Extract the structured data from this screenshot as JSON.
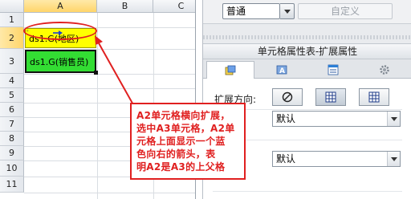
{
  "sheet": {
    "columns": [
      "A",
      "B",
      "C"
    ],
    "rows": [
      "1",
      "2",
      "3",
      "4",
      "5",
      "6",
      "7",
      "8",
      "9",
      "10",
      "11"
    ],
    "cells": {
      "a2": "ds1.G(地区)",
      "a3": "ds1.G(销售员)"
    },
    "selection_fill": "#ffff00",
    "green_fill": "#33dd33"
  },
  "panel": {
    "format_combo": "普通",
    "custom_button": "自定义",
    "title": "单元格属性表-扩展属性",
    "tab_icons": [
      "cell-format-icon",
      "text-style-icon",
      "cell-properties-icon",
      "gear-icon"
    ],
    "expand_direction_label": "扩展方向:",
    "direction_buttons": [
      "no-expand-icon",
      "vertical-expand-icon",
      "horizontal-expand-icon"
    ],
    "dropdown_1": "默认",
    "dropdown_2": "默认"
  },
  "callout": {
    "lines": [
      "A2单元格横向扩展，",
      "选中A3单元格，A2单",
      "元格上面显示一个蓝",
      "色向右的箭头，表",
      "明A2是A3的上父格"
    ]
  },
  "accent_red": "#e02020"
}
